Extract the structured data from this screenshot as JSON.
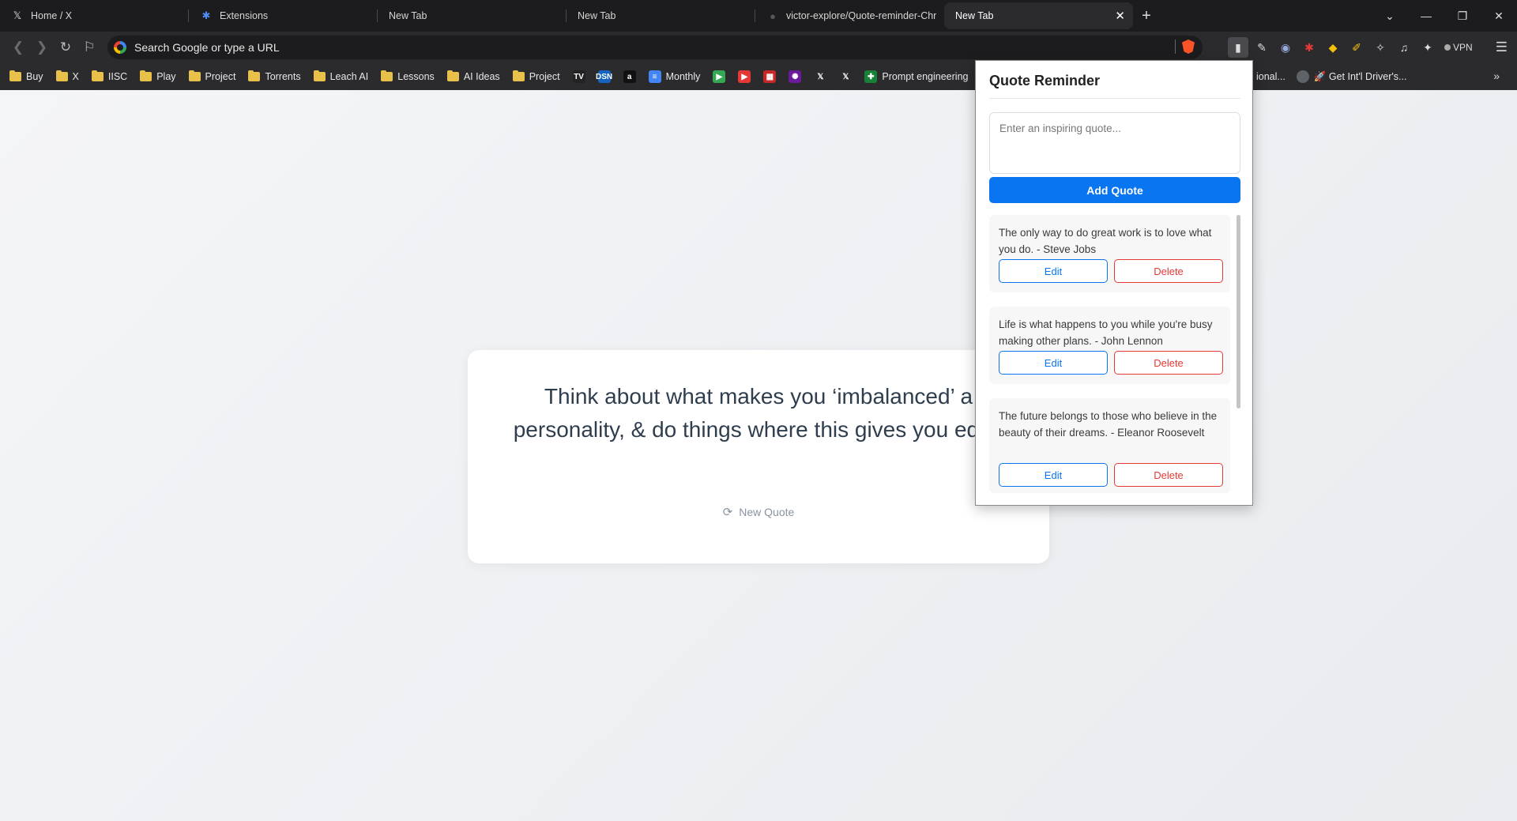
{
  "tabs": [
    {
      "title": "Home / X",
      "icon": "x-logo-icon",
      "active": false
    },
    {
      "title": "Extensions",
      "icon": "puzzle-icon",
      "active": false
    },
    {
      "title": "New Tab",
      "icon": "",
      "active": false
    },
    {
      "title": "New Tab",
      "icon": "",
      "active": false
    },
    {
      "title": "victor-explore/Quote-reminder-Chr",
      "icon": "github-icon",
      "active": false
    },
    {
      "title": "New Tab",
      "icon": "",
      "active": true
    }
  ],
  "omnibox": {
    "placeholder": "Search Google or type a URL"
  },
  "toolbar": {
    "vpn_label": "VPN"
  },
  "bookmarks": [
    {
      "label": "Buy",
      "type": "folder"
    },
    {
      "label": "X",
      "type": "folder"
    },
    {
      "label": "IISC",
      "type": "folder"
    },
    {
      "label": "Play",
      "type": "folder"
    },
    {
      "label": "Project",
      "type": "folder"
    },
    {
      "label": "Torrents",
      "type": "folder"
    },
    {
      "label": "Leach AI",
      "type": "folder"
    },
    {
      "label": "Lessons",
      "type": "folder"
    },
    {
      "label": "AI Ideas",
      "type": "folder"
    },
    {
      "label": "Project",
      "type": "folder"
    },
    {
      "label": "",
      "type": "site",
      "icon": "tradingview-icon",
      "glyph": "TV",
      "color": "#222"
    },
    {
      "label": "",
      "type": "site",
      "icon": "dsn-icon",
      "glyph": "DSN",
      "color": "#1565c0"
    },
    {
      "label": "",
      "type": "site",
      "icon": "amazon-icon",
      "glyph": "a",
      "color": "#111"
    },
    {
      "label": "Monthly",
      "type": "site",
      "icon": "docs-icon",
      "glyph": "≡",
      "color": "#4285f4"
    },
    {
      "label": "",
      "type": "site",
      "icon": "play-icon",
      "glyph": "▶",
      "color": "#34a853"
    },
    {
      "label": "",
      "type": "site",
      "icon": "youtube-icon",
      "glyph": "▶",
      "color": "#e53935"
    },
    {
      "label": "",
      "type": "site",
      "icon": "film-icon",
      "glyph": "▦",
      "color": "#c62828"
    },
    {
      "label": "",
      "type": "site",
      "icon": "audio-wave-icon",
      "glyph": "✺",
      "color": "#6a1b9a"
    },
    {
      "label": "",
      "type": "site",
      "icon": "x-logo-icon",
      "glyph": "𝕏",
      "color": "#2b2b2e"
    },
    {
      "label": "",
      "type": "site",
      "icon": "x-logo-icon",
      "glyph": "𝕏",
      "color": "#2b2b2e"
    },
    {
      "label": "Prompt engineering",
      "type": "site",
      "icon": "sheets-icon",
      "glyph": "✚",
      "color": "#188038"
    }
  ],
  "bookmarks_right": [
    {
      "label": "ional...",
      "icon": "globe-icon"
    },
    {
      "label": "🚀 Get Int'l Driver's...",
      "icon": "globe-icon"
    }
  ],
  "quote_card": {
    "text": "Think about what makes you ‘imbalanced’ a personality, & do things where this gives you edge",
    "new_quote_label": "New Quote"
  },
  "popup": {
    "title": "Quote Reminder",
    "input_placeholder": "Enter an inspiring quote...",
    "add_label": "Add Quote",
    "edit_label": "Edit",
    "delete_label": "Delete",
    "quotes": [
      "The only way to do great work is to love what you do. - Steve Jobs",
      "Life is what happens to you while you're busy making other plans. - John Lennon",
      "The future belongs to those who believe in the beauty of their dreams. - Eleanor Roosevelt"
    ]
  },
  "colors": {
    "accent": "#0a75f0",
    "danger": "#e53935",
    "chrome_dark": "#1c1c1e",
    "toolbar": "#2b2b2e"
  }
}
